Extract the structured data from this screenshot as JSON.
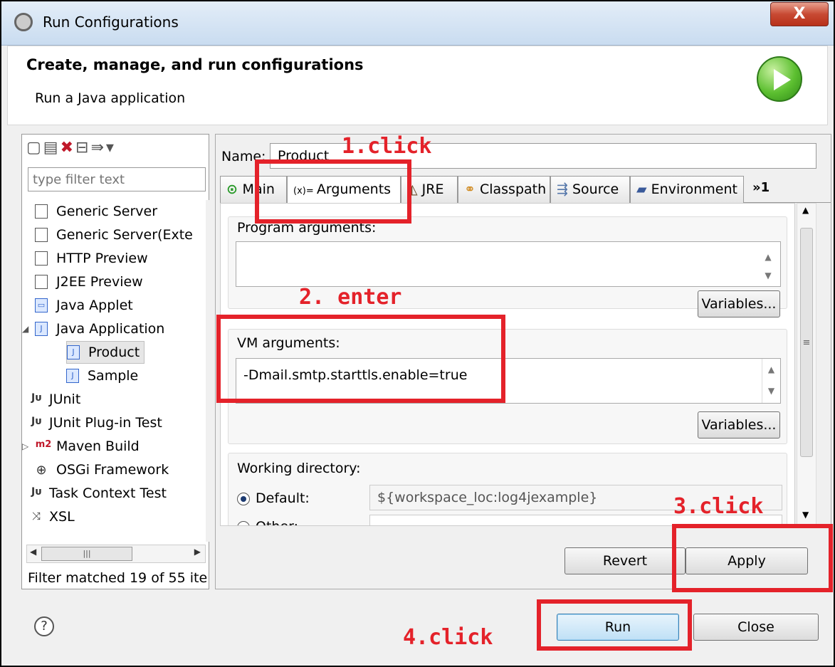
{
  "window": {
    "title": "Run Configurations",
    "close_label": "X"
  },
  "header": {
    "title": "Create, manage, and run configurations",
    "subtitle": "Run a Java application"
  },
  "left": {
    "filter_placeholder": "type filter text",
    "items": [
      {
        "label": "Generic Server"
      },
      {
        "label": "Generic Server(Exte"
      },
      {
        "label": "HTTP Preview"
      },
      {
        "label": "J2EE Preview"
      },
      {
        "label": "Java Applet"
      },
      {
        "label": "Java Application"
      },
      {
        "label": "Product"
      },
      {
        "label": "Sample"
      },
      {
        "label": "JUnit"
      },
      {
        "label": "JUnit Plug-in Test"
      },
      {
        "label": "Maven Build"
      },
      {
        "label": "OSGi Framework"
      },
      {
        "label": "Task Context Test"
      },
      {
        "label": "XSL"
      }
    ],
    "status": "Filter matched 19 of 55 ite"
  },
  "main": {
    "name_label": "Name:",
    "name_value": "Product",
    "tabs": [
      {
        "label": "Main"
      },
      {
        "label": "Arguments"
      },
      {
        "label": "JRE"
      },
      {
        "label": "Classpath"
      },
      {
        "label": "Source"
      },
      {
        "label": "Environment"
      }
    ],
    "tabs_overflow": "»1",
    "program_args_label": "Program arguments:",
    "program_args_value": "",
    "variables_label": "Variables...",
    "vm_args_label": "VM arguments:",
    "vm_args_value": "-Dmail.smtp.starttls.enable=true",
    "working_dir_label": "Working directory:",
    "default_label": "Default:",
    "default_value": "${workspace_loc:log4jexample}",
    "other_label": "Other:",
    "revert_label": "Revert",
    "apply_label": "Apply"
  },
  "footer": {
    "run_label": "Run",
    "close_label": "Close"
  },
  "annotations": {
    "step1": "1.click",
    "step2": "2. enter",
    "step3": "3.click",
    "step4": "4.click",
    "color": "#e4222a"
  }
}
